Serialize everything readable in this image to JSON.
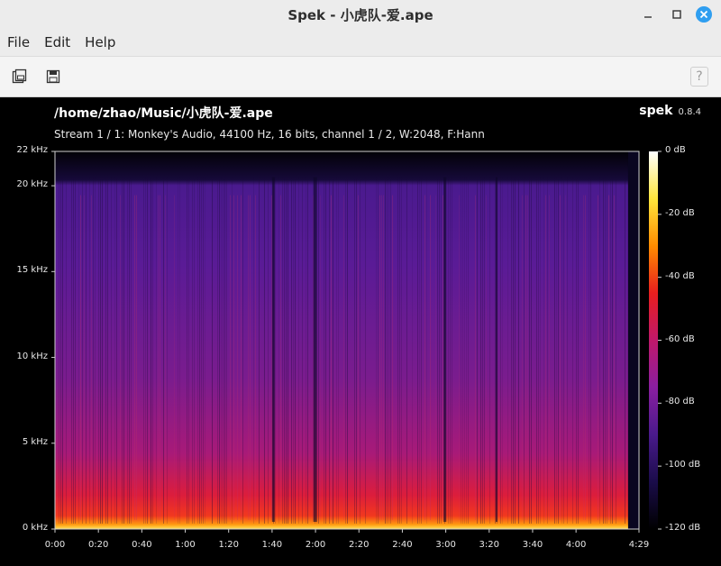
{
  "window": {
    "title": "Spek - 小虎队-爱.ape",
    "controls": {
      "minimize": "–",
      "maximize": "□",
      "close": "✕"
    }
  },
  "menu": {
    "items": [
      "File",
      "Edit",
      "Help"
    ]
  },
  "toolbar": {
    "open_icon": "open-file-icon",
    "save_icon": "save-icon",
    "help_label": "?"
  },
  "viewer": {
    "file_path": "/home/zhao/Music/小虎队-爱.ape",
    "stream_info": "Stream 1 / 1: Monkey's Audio, 44100 Hz, 16 bits, channel 1 / 2, W:2048, F:Hann",
    "app_name": "spek",
    "app_version": "0.8.4"
  },
  "chart_data": {
    "type": "heatmap",
    "title": "",
    "xlabel": "",
    "ylabel": "",
    "x_ticks": [
      "0:00",
      "0:20",
      "0:40",
      "1:00",
      "1:20",
      "1:40",
      "2:00",
      "2:20",
      "2:40",
      "3:00",
      "3:20",
      "3:40",
      "4:00",
      "4:29"
    ],
    "x_range_seconds": [
      0,
      269
    ],
    "y_ticks": [
      "0 kHz",
      "5 kHz",
      "10 kHz",
      "15 kHz",
      "20 kHz",
      "22 kHz"
    ],
    "y_range_khz": [
      0,
      22
    ],
    "color_scale_ticks": [
      "0 dB",
      "-20 dB",
      "-40 dB",
      "-60 dB",
      "-80 dB",
      "-100 dB",
      "-120 dB"
    ],
    "color_scale_range_db": [
      -120,
      0
    ],
    "colormap": [
      "#000000",
      "#1a0c4a",
      "#4a1a8c",
      "#8a1ea0",
      "#c0186a",
      "#e81e1e",
      "#ff8c00",
      "#ffe63c",
      "#ffffff"
    ],
    "content_cutoff_khz": 20.5,
    "audio_end_seconds": 264
  }
}
